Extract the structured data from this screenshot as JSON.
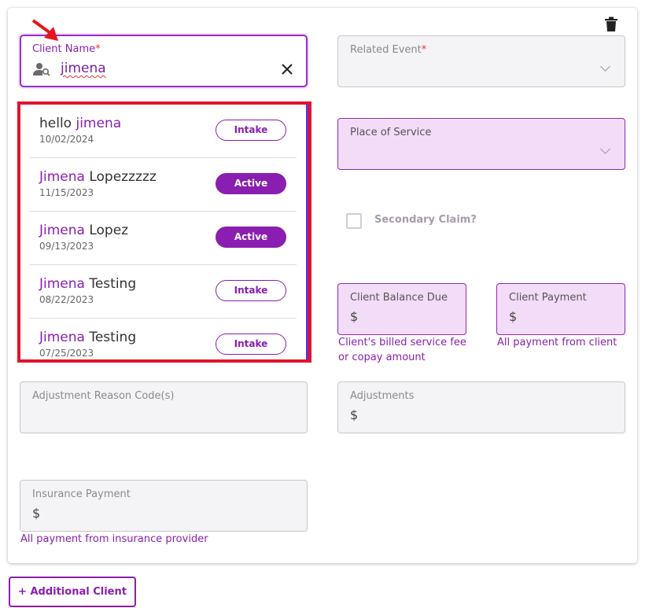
{
  "client_name": {
    "label": "Client Name",
    "required_mark": "*",
    "value": "jimena",
    "suggestions": [
      {
        "prefix": "hello ",
        "match": "jimena",
        "suffix": "",
        "date": "10/02/2024",
        "status": "Intake"
      },
      {
        "prefix": "",
        "match": "Jimena",
        "suffix": " Lopezzzzz",
        "date": "11/15/2023",
        "status": "Active"
      },
      {
        "prefix": "",
        "match": "Jimena",
        "suffix": " Lopez",
        "date": "09/13/2023",
        "status": "Active"
      },
      {
        "prefix": "",
        "match": "Jimena",
        "suffix": " Testing",
        "date": "08/22/2023",
        "status": "Intake"
      },
      {
        "prefix": "",
        "match": "Jimena",
        "suffix": " Testing",
        "date": "07/25/2023",
        "status": "Intake"
      }
    ]
  },
  "related_event": {
    "label": "Related Event",
    "required_mark": "*"
  },
  "place_of_service": {
    "label": "Place of Service"
  },
  "secondary_claim": {
    "label": "Secondary Claim?",
    "checked": false
  },
  "client_balance_due": {
    "label": "Client Balance Due",
    "value": "$",
    "helper": "Client's billed service fee or copay amount"
  },
  "client_payment": {
    "label": "Client Payment",
    "value": "$",
    "helper": "All payment from client"
  },
  "adjustment_reason": {
    "label": "Adjustment Reason Code(s)"
  },
  "adjustments": {
    "label": "Adjustments",
    "value": "$"
  },
  "insurance_payment": {
    "label": "Insurance Payment",
    "value": "$",
    "helper": "All payment from insurance provider"
  },
  "actions": {
    "add_client": "+ Additional Client"
  },
  "icons": {
    "delete": "trash-icon",
    "client": "person-search-icon",
    "clear": "close-icon",
    "annotation": "red-arrow"
  },
  "colors": {
    "accent": "#8a1eb0",
    "highlight_outline": "#e3132b",
    "purple_field_bg": "#f3dcf8"
  }
}
